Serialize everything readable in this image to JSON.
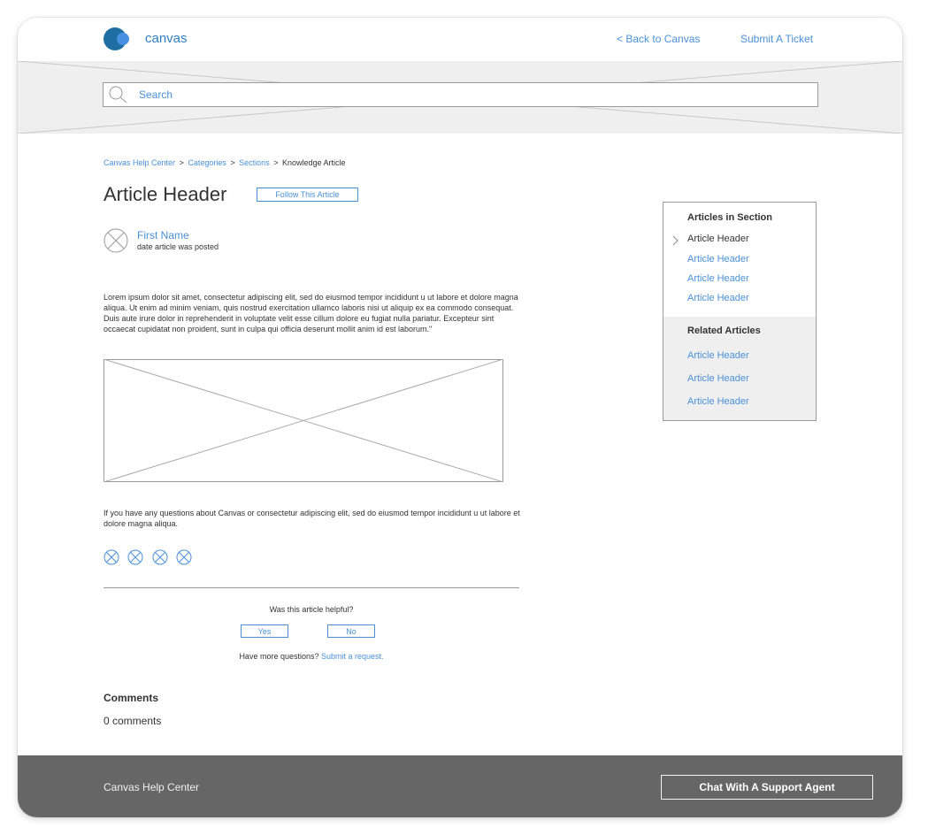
{
  "header": {
    "logo_text": "canvas",
    "back_link": "< Back to Canvas",
    "ticket_link": "Submit A Ticket"
  },
  "search": {
    "placeholder": "Search"
  },
  "breadcrumb": {
    "items": [
      "Canvas Help Center",
      "Categories",
      "Sections"
    ],
    "current": "Knowledge Article",
    "separator": ">"
  },
  "article": {
    "title": "Article Header",
    "follow_label": "Follow This Article",
    "author_name": "First Name",
    "author_date": "date article was posted",
    "body": "Lorem ipsum dolor sit amet, consectetur adipiscing elit, sed do eiusmod tempor incididunt u ut labore et dolore magna aliqua. Ut enim ad minim veniam, quis nostrud exercitation ullamco laboris nisi ut aliquip ex ea commodo consequat. Duis aute irure dolor in reprehenderit in voluptate velit esse cillum dolore eu fugiat nulla pariatur. Excepteur sint occaecat cupidatat non proident, sunt in culpa qui officia deserunt mollit anim id est laborum.\"",
    "body2": "If you have any questions about Canvas or consectetur adipiscing elit, sed do eiusmod tempor incididunt u ut labore et dolore magna aliqua.",
    "helpful_question": "Was this article helpful?",
    "yes_label": "Yes",
    "no_label": "No",
    "more_questions": "Have more questions?",
    "submit_request": "Submit a request."
  },
  "comments": {
    "title": "Comments",
    "count": "0 comments"
  },
  "sidebar": {
    "section_title": "Articles in Section",
    "section_items": [
      "Article Header",
      "Article Header",
      "Article Header",
      "Article Header"
    ],
    "related_title": "Related Articles",
    "related_items": [
      "Article Header",
      "Article Header",
      "Article Header"
    ]
  },
  "footer": {
    "title": "Canvas Help Center",
    "chat_label": "Chat With A Support Agent"
  },
  "colors": {
    "link": "#4a90d9",
    "footer_bg": "#666666",
    "hero_bg": "#efefef",
    "logo_dark": "#1f6ea3",
    "logo_light": "#4a90e2"
  }
}
